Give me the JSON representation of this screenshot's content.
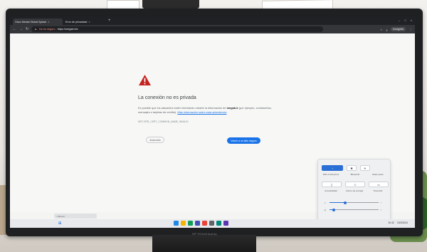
{
  "browser": {
    "tabs": [
      {
        "label": "Cisco Meraki Global Splash",
        "active": true
      },
      {
        "label": "Error de privacidad",
        "active": false
      }
    ],
    "new_tab_symbol": "+",
    "omnibox": {
      "security_label": "No es seguro",
      "url": "https://megab.b/c"
    },
    "profile_label": "Incógnito"
  },
  "error_page": {
    "title": "La conexión no es privada",
    "body_prefix": "Es posible que los atacantes estén intentando robarte la información de",
    "body_host": "megab.b",
    "body_suffix": "(por ejemplo, contraseñas, mensajes o tarjetas de crédito).",
    "body_link": "Más información sobre esta advertencia",
    "error_code": "NET::ERR_CERT_COMMON_NAME_INVALID",
    "advanced_button": "Avanzado",
    "back_button": "Volver a un sitio seguro"
  },
  "quick_settings": {
    "tiles_row1": [
      {
        "icon": "wifi-icon",
        "symbol": "◔",
        "on": true
      },
      {
        "icon": "bluetooth-icon",
        "symbol": "✱",
        "on": false
      },
      {
        "icon": "airplane-icon",
        "symbol": "✈",
        "on": false
      }
    ],
    "labels_row1": [
      "WiFi-Conference",
      "Bluetooth",
      "Modo avión"
    ],
    "tiles_row2": [
      {
        "icon": "battery-saver-icon",
        "symbol": "▯",
        "on": false
      },
      {
        "icon": "accessibility-icon",
        "symbol": "☺",
        "on": false
      },
      {
        "icon": "cast-icon",
        "symbol": "▭",
        "on": false
      }
    ],
    "labels_row2": [
      "Accesibilidad",
      "Ahorro de energía",
      "Transmitir"
    ],
    "sliders": [
      {
        "icon": "brightness-icon",
        "symbol": "☼",
        "level": 0.32
      },
      {
        "icon": "volume-icon",
        "symbol": "◁",
        "level": 0.08
      }
    ]
  },
  "taskbar": {
    "search_placeholder": "Buscar",
    "tray_time": "10:42",
    "tray_date": "15/3/2024",
    "apps_colors": [
      "#1e88e5",
      "#f4b400",
      "#0f9d58",
      "#3f51b5",
      "#ea4335",
      "#5f6368",
      "#00897b",
      "#5e35b1"
    ]
  },
  "monitor_brand": "HP EliteDisplay"
}
